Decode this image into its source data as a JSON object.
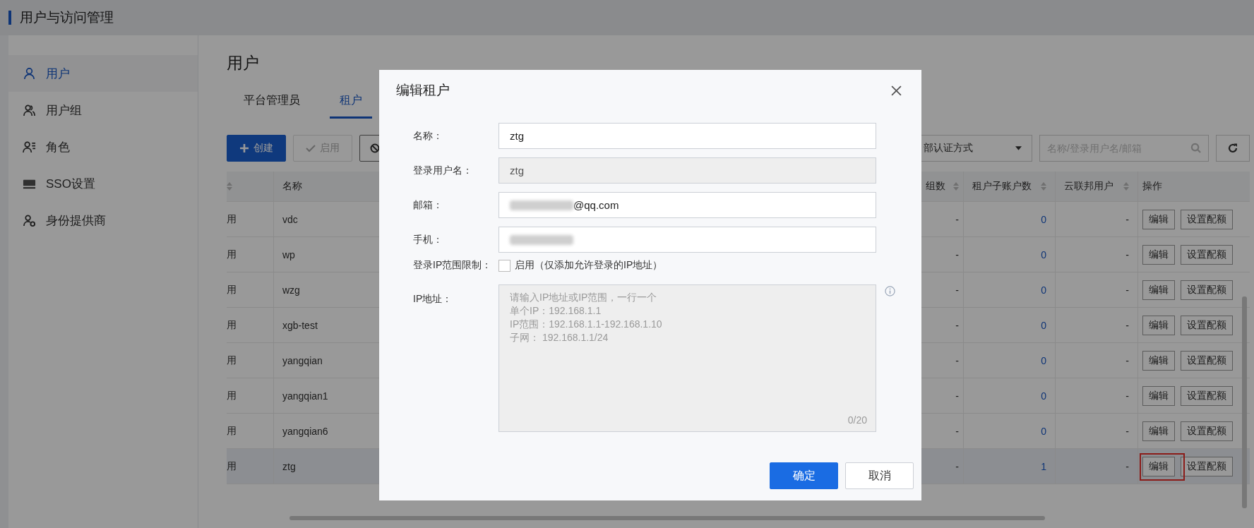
{
  "header": {
    "title": "用户与访问管理"
  },
  "sidebar": {
    "items": [
      {
        "label": "用户",
        "selected": true
      },
      {
        "label": "用户组",
        "selected": false
      },
      {
        "label": "角色",
        "selected": false
      },
      {
        "label": "SSO设置",
        "selected": false
      },
      {
        "label": "身份提供商",
        "selected": false
      }
    ]
  },
  "page": {
    "title": "用户"
  },
  "tabs": [
    {
      "label": "平台管理员",
      "selected": false
    },
    {
      "label": "租户",
      "selected": true
    }
  ],
  "toolbar": {
    "buttons": [
      {
        "label": "创建",
        "kind": "primary",
        "disabled": false
      },
      {
        "label": "启用",
        "kind": "enable",
        "disabled": true
      },
      {
        "kind": "disable",
        "disabled": false
      }
    ],
    "auth_filter": {
      "value": "部认证方式"
    },
    "search": {
      "placeholder": "名称/登录用户名/邮箱"
    }
  },
  "table": {
    "columns": [
      {
        "sortable": true
      },
      {
        "label": "名称",
        "sortable": false
      },
      {
        "label": "组数",
        "sortable": true
      },
      {
        "label": "租户子账户数",
        "sortable": true
      },
      {
        "label": "云联邦用户",
        "sortable": true
      },
      {
        "label": "操作",
        "sortable": false
      }
    ],
    "rows": [
      {
        "status": "用",
        "name": "vdc",
        "groups": "-",
        "sub_accounts": "0",
        "federated": "-",
        "actions": [
          "编辑",
          "设置配额"
        ],
        "selected": false,
        "edit_highlighted": false
      },
      {
        "status": "用",
        "name": "wp",
        "groups": "-",
        "sub_accounts": "0",
        "federated": "-",
        "actions": [
          "编辑",
          "设置配额"
        ],
        "selected": false,
        "edit_highlighted": false
      },
      {
        "status": "用",
        "name": "wzg",
        "groups": "-",
        "sub_accounts": "0",
        "federated": "-",
        "actions": [
          "编辑",
          "设置配额"
        ],
        "selected": false,
        "edit_highlighted": false
      },
      {
        "status": "用",
        "name": "xgb-test",
        "groups": "-",
        "sub_accounts": "0",
        "federated": "-",
        "actions": [
          "编辑",
          "设置配额"
        ],
        "selected": false,
        "edit_highlighted": false
      },
      {
        "status": "用",
        "name": "yangqian",
        "groups": "-",
        "sub_accounts": "0",
        "federated": "-",
        "actions": [
          "编辑",
          "设置配额"
        ],
        "selected": false,
        "edit_highlighted": false
      },
      {
        "status": "用",
        "name": "yangqian1",
        "groups": "-",
        "sub_accounts": "0",
        "federated": "-",
        "actions": [
          "编辑",
          "设置配额"
        ],
        "selected": false,
        "edit_highlighted": false
      },
      {
        "status": "用",
        "name": "yangqian6",
        "groups": "-",
        "sub_accounts": "0",
        "federated": "-",
        "actions": [
          "编辑",
          "设置配额"
        ],
        "selected": false,
        "edit_highlighted": false
      },
      {
        "status": "用",
        "name": "ztg",
        "groups": "-",
        "sub_accounts": "1",
        "federated": "-",
        "actions": [
          "编辑",
          "设置配额"
        ],
        "selected": true,
        "edit_highlighted": true
      }
    ]
  },
  "dialog": {
    "title": "编辑租户",
    "fields": [
      {
        "label": "名称：",
        "kind": "text",
        "value": "ztg",
        "disabled": false,
        "redacted": false
      },
      {
        "label": "登录用户名：",
        "kind": "text",
        "value": "ztg",
        "disabled": true,
        "redacted": false
      },
      {
        "label": "邮箱：",
        "kind": "text",
        "value": "@qq.com",
        "disabled": false,
        "redacted": true
      },
      {
        "label": "手机：",
        "kind": "text",
        "disabled": false,
        "redacted": true
      },
      {
        "label": "登录IP范围限制：",
        "kind": "checkbox",
        "checked": false,
        "text": "启用（仅添加允许登录的IP地址）"
      },
      {
        "label": "IP地址：",
        "kind": "textarea",
        "disabled": true,
        "placeholder_lines": [
          "请输入IP地址或IP范围，一行一个",
          "单个IP：192.168.1.1",
          "IP范围：192.168.1.1-192.168.1.10",
          "子网： 192.168.1.1/24"
        ],
        "counter": "0/20"
      }
    ],
    "buttons": [
      {
        "label": "确定",
        "kind": "primary"
      },
      {
        "label": "取消",
        "kind": "default"
      }
    ]
  }
}
